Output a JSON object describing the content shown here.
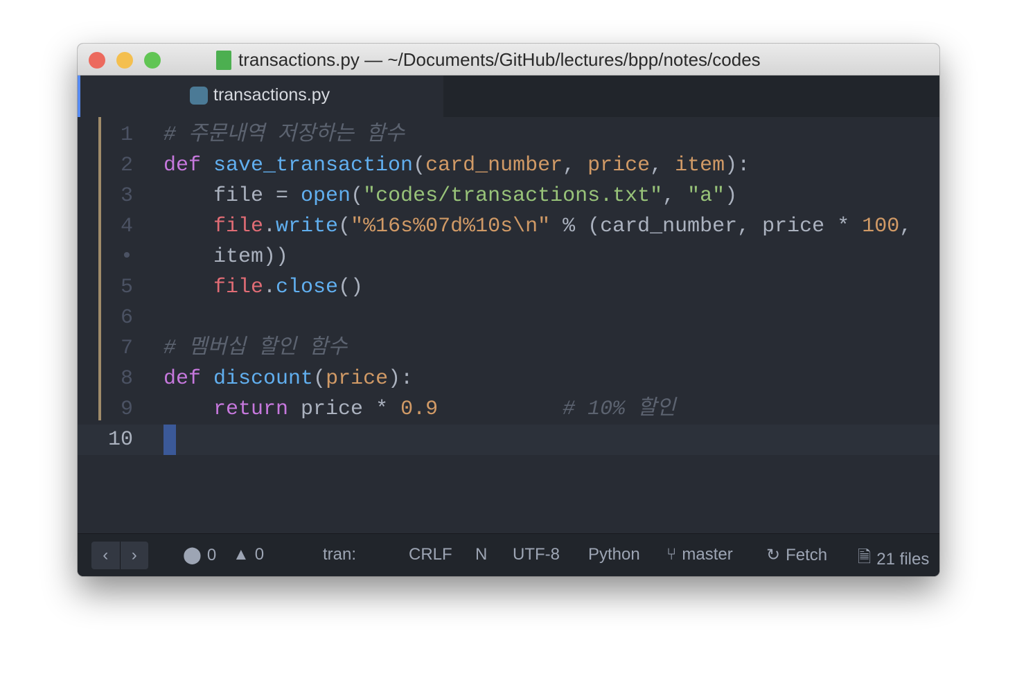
{
  "window": {
    "title": "transactions.py — ~/Documents/GitHub/lectures/bpp/notes/codes"
  },
  "tab": {
    "label": "transactions.py"
  },
  "colors": {
    "bg": "#282c34",
    "keyword": "#c678dd",
    "function": "#61afef",
    "param": "#d19a66",
    "string": "#98c379",
    "variable": "#e06c75",
    "comment": "#5c6370",
    "text": "#abb2bf"
  },
  "lines": [
    {
      "n": "1",
      "tokens": [
        [
          "# 주문내역 저장하는 함수",
          "c"
        ]
      ]
    },
    {
      "n": "2",
      "tokens": [
        [
          "def ",
          "k"
        ],
        [
          "save_transaction",
          "f"
        ],
        [
          "(",
          "t"
        ],
        [
          "card_number",
          "p"
        ],
        [
          ", ",
          "t"
        ],
        [
          "price",
          "p"
        ],
        [
          ", ",
          "t"
        ],
        [
          "item",
          "p"
        ],
        [
          "):",
          "t"
        ]
      ]
    },
    {
      "n": "3",
      "tokens": [
        [
          "    file = ",
          "t"
        ],
        [
          "open",
          "b"
        ],
        [
          "(",
          "t"
        ],
        [
          "\"codes/transactions.txt\"",
          "s"
        ],
        [
          ", ",
          "t"
        ],
        [
          "\"a\"",
          "s"
        ],
        [
          ")",
          "t"
        ]
      ]
    },
    {
      "n": "4",
      "tokens": [
        [
          "    ",
          "t"
        ],
        [
          "file",
          "v"
        ],
        [
          ".",
          "t"
        ],
        [
          "write",
          "f"
        ],
        [
          "(",
          "t"
        ],
        [
          "\"%16s%07d%10s\\n\"",
          "s2"
        ],
        [
          " % (card_number, price * ",
          "t"
        ],
        [
          "100",
          "p"
        ],
        [
          ",",
          "t"
        ]
      ]
    },
    {
      "n": "•",
      "tokens": [
        [
          "    item))",
          "t"
        ]
      ]
    },
    {
      "n": "5",
      "tokens": [
        [
          "    ",
          "t"
        ],
        [
          "file",
          "v"
        ],
        [
          ".",
          "t"
        ],
        [
          "close",
          "f"
        ],
        [
          "()",
          "t"
        ]
      ]
    },
    {
      "n": "6",
      "tokens": []
    },
    {
      "n": "7",
      "tokens": [
        [
          "# 멤버십 할인 함수",
          "c"
        ]
      ]
    },
    {
      "n": "8",
      "tokens": [
        [
          "def ",
          "k"
        ],
        [
          "discount",
          "f"
        ],
        [
          "(",
          "t"
        ],
        [
          "price",
          "p"
        ],
        [
          "):",
          "t"
        ]
      ]
    },
    {
      "n": "9",
      "tokens": [
        [
          "    ",
          "t"
        ],
        [
          "return",
          "k"
        ],
        [
          " price * ",
          "t"
        ],
        [
          "0.9",
          "p"
        ],
        [
          "          ",
          "t"
        ],
        [
          "# 10% 할인",
          "c"
        ]
      ]
    },
    {
      "n": "10",
      "tokens": []
    }
  ],
  "status": {
    "nav_back": "‹",
    "nav_forward": "›",
    "errors": "0",
    "warnings": "0",
    "file": "tran:",
    "line_ending": "CRLF",
    "n": "N",
    "encoding": "UTF-8",
    "grammar": "Python",
    "branch": "master",
    "fetch": "Fetch",
    "files": "21 files"
  }
}
